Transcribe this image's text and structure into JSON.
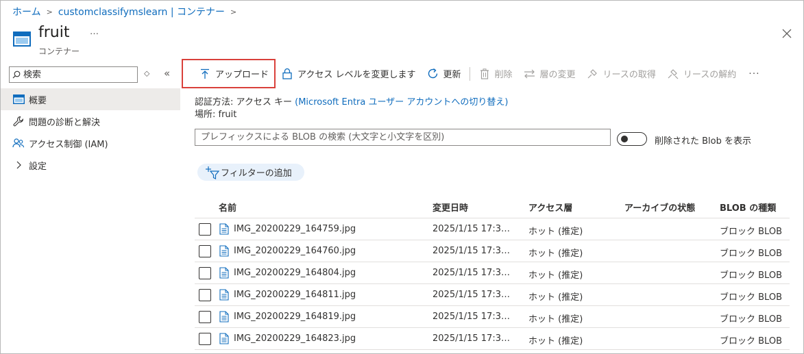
{
  "breadcrumb": [
    "ホーム",
    "customclassifymslearn | コンテナー"
  ],
  "header": {
    "title": "fruit",
    "subtitle": "コンテナー",
    "more_label": "…"
  },
  "sidebar": {
    "search_placeholder": "検索",
    "items": [
      {
        "label": "概要",
        "icon": "container-icon",
        "active": true
      },
      {
        "label": "問題の診断と解決",
        "icon": "wrench-icon"
      },
      {
        "label": "アクセス制御 (IAM)",
        "icon": "people-icon"
      },
      {
        "label": "設定",
        "icon": "chevron-right-icon"
      }
    ]
  },
  "toolbar": {
    "upload": "アップロード",
    "change_access": "アクセス レベルを変更します",
    "refresh": "更新",
    "delete": "削除",
    "change_tier": "層の変更",
    "acquire_lease": "リースの取得",
    "break_lease": "リースの解約",
    "more": "···"
  },
  "info": {
    "auth_label": "認証方法: アクセス キー",
    "auth_link": "(Microsoft Entra ユーザー アカウントへの切り替え)",
    "location": "場所: fruit"
  },
  "blob_search_placeholder": "プレフィックスによる BLOB の検索 (大文字と小文字を区別)",
  "show_deleted_label": "削除された Blob を表示",
  "add_filter_label": "フィルターの追加",
  "table": {
    "headers": {
      "name": "名前",
      "modified": "変更日時",
      "tier": "アクセス層",
      "archive": "アーカイブの状態",
      "blob_type": "BLOB の種類"
    },
    "rows": [
      {
        "name": "IMG_20200229_164759.jpg",
        "modified": "2025/1/15 17:3…",
        "tier": "ホット (推定)",
        "archive": "",
        "blob_type": "ブロック BLOB"
      },
      {
        "name": "IMG_20200229_164760.jpg",
        "modified": "2025/1/15 17:3…",
        "tier": "ホット (推定)",
        "archive": "",
        "blob_type": "ブロック BLOB"
      },
      {
        "name": "IMG_20200229_164804.jpg",
        "modified": "2025/1/15 17:3…",
        "tier": "ホット (推定)",
        "archive": "",
        "blob_type": "ブロック BLOB"
      },
      {
        "name": "IMG_20200229_164811.jpg",
        "modified": "2025/1/15 17:3…",
        "tier": "ホット (推定)",
        "archive": "",
        "blob_type": "ブロック BLOB"
      },
      {
        "name": "IMG_20200229_164819.jpg",
        "modified": "2025/1/15 17:3…",
        "tier": "ホット (推定)",
        "archive": "",
        "blob_type": "ブロック BLOB"
      },
      {
        "name": "IMG_20200229_164823.jpg",
        "modified": "2025/1/15 17:3…",
        "tier": "ホット (推定)",
        "archive": "",
        "blob_type": "ブロック BLOB"
      }
    ]
  },
  "colors": {
    "accent": "#0f6cbd",
    "highlight_border": "#d9403a",
    "active_nav": "#edebe9",
    "filter_pill": "#e8f1fb"
  }
}
